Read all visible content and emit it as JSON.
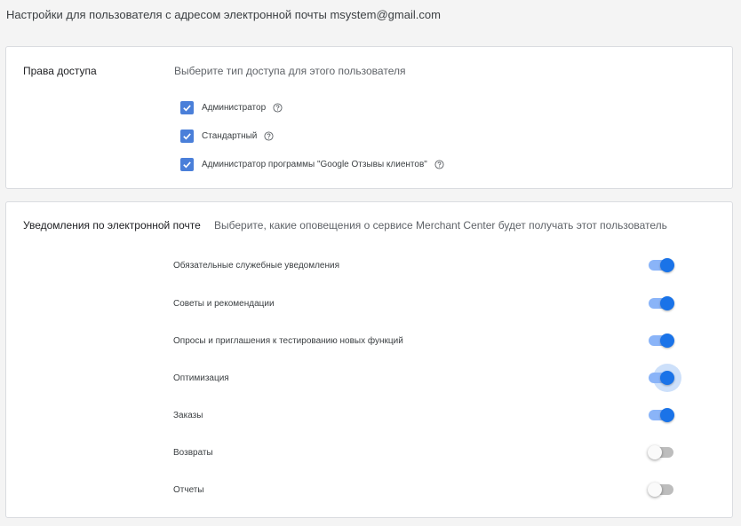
{
  "header": {
    "title": "Настройки для пользователя с адресом электронной почты msystem@gmail.com"
  },
  "access": {
    "title": "Права доступа",
    "description": "Выберите тип доступа для этого пользователя",
    "options": [
      {
        "label": "Администратор",
        "checked": true
      },
      {
        "label": "Стандартный",
        "checked": true
      },
      {
        "label": "Администратор программы \"Google Отзывы клиентов\"",
        "checked": true
      }
    ]
  },
  "notifications": {
    "title": "Уведомления по электронной почте",
    "description": "Выберите, какие оповещения о сервисе Merchant Center будет получать этот пользователь",
    "items": [
      {
        "label": "Обязательные служебные уведомления",
        "enabled": true
      },
      {
        "label": "Советы и рекомендации",
        "enabled": true
      },
      {
        "label": "Опросы и приглашения к тестированию новых функций",
        "enabled": true
      },
      {
        "label": "Оптимизация",
        "enabled": true
      },
      {
        "label": "Заказы",
        "enabled": true
      },
      {
        "label": "Возвраты",
        "enabled": false
      },
      {
        "label": "Отчеты",
        "enabled": false
      }
    ]
  },
  "colors": {
    "accent": "#1a73e8",
    "checkbox": "#4a7fd9",
    "toggle_track_on": "#8ab4f8",
    "toggle_track_off": "#bdbdbd"
  }
}
